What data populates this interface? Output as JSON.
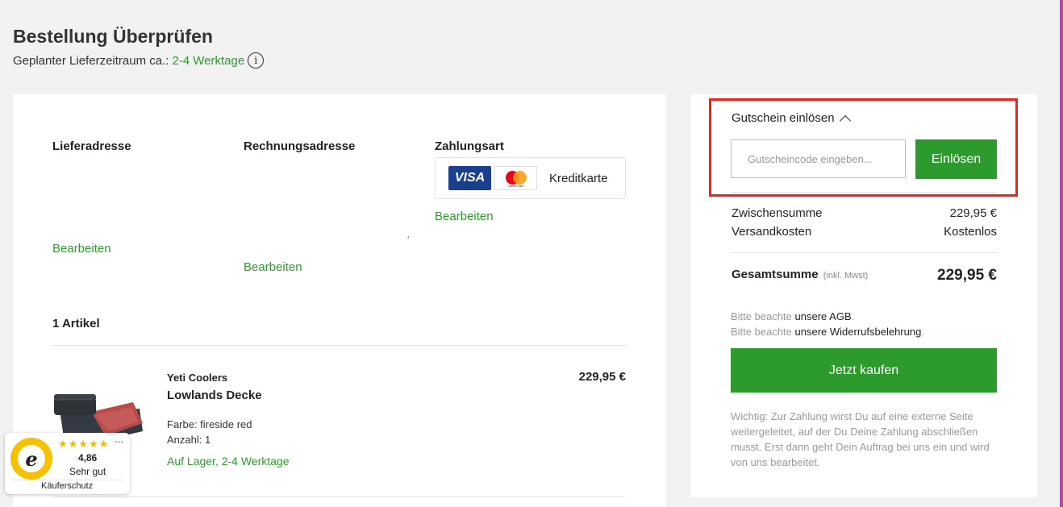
{
  "header": {
    "title": "Bestellung Überprüfen",
    "delivery_prefix": "Geplanter Lieferzeitraum ca.:",
    "delivery_time": "2-4 Werktage",
    "info_glyph": "i"
  },
  "addresses": {
    "shipping_heading": "Lieferadresse",
    "billing_heading": "Rechnungsadresse",
    "payment_heading": "Zahlungsart",
    "edit_label": "Bearbeiten",
    "payment_method": "Kreditkarte",
    "visa_label": "VISA",
    "mastercard_label": "mastercard",
    "stray_mark": "ʻ"
  },
  "cart": {
    "count_label": "1 Artikel",
    "items": [
      {
        "brand": "Yeti Coolers",
        "name": "Lowlands Decke",
        "price": "229,95 €",
        "color": "Farbe: fireside red",
        "quantity": "Anzahl: 1",
        "stock": "Auf Lager, 2-4 Werktage"
      }
    ]
  },
  "trust_badge": {
    "stars": "★★★★★",
    "more": "...",
    "score": "4,86",
    "rating_label": "Sehr gut",
    "footer": "Käuferschutz",
    "seal_letter": "e"
  },
  "summary": {
    "voucher_toggle": "Gutschein einlösen",
    "voucher_placeholder": "Gutscheincode eingeben...",
    "redeem_label": "Einlösen",
    "subtotal_label": "Zwischensumme",
    "subtotal_value": "229,95 €",
    "shipping_label": "Versandkosten",
    "shipping_value": "Kostenlos",
    "total_label": "Gesamtsumme",
    "total_vat": "(inkl. Mwst)",
    "total_value": "229,95 €",
    "note_prefix": "Bitte beachte",
    "agb_link": "unsere AGB",
    "withdrawal_link": "unsere Widerrufsbelehrung",
    "buy_label": "Jetzt kaufen",
    "important": "Wichtig: Zur Zahlung wirst Du auf eine externe Seite weitergeleitet, auf der Du Deine Zahlung abschließen musst. Erst dann geht Dein Auftrag bei uns ein und wird von uns bearbeitet."
  },
  "colors": {
    "accent_green": "#2d9a2d",
    "highlight_red": "#e8241c",
    "visa_blue": "#1a3f8f"
  }
}
